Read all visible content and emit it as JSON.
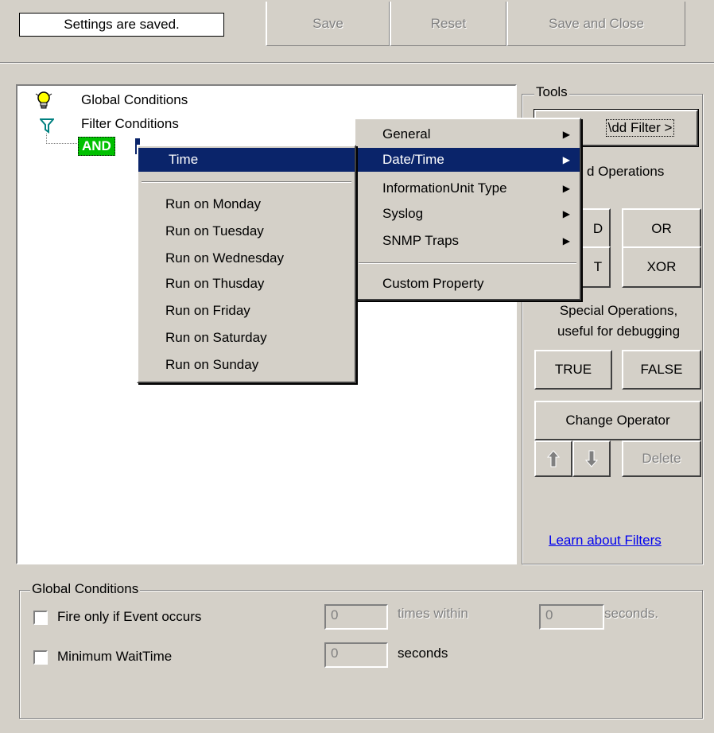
{
  "status_text": "Settings are saved.",
  "toolbar": {
    "save": "Save",
    "reset": "Reset",
    "save_close": "Save and Close"
  },
  "tree": {
    "global_conditions": "Global Conditions",
    "filter_conditions": "Filter Conditions",
    "and_node": "AND"
  },
  "tools": {
    "legend": "Tools",
    "add_filter": "Add Filter >",
    "add_filter_visible": "\\dd Filter >",
    "operations_label": "d Operations",
    "and_partial": "D",
    "or": "OR",
    "not_partial": "T",
    "xor": "XOR",
    "special_line1": "Special Operations,",
    "special_line2": "useful for debugging",
    "true": "TRUE",
    "false": "FALSE",
    "change_operator": "Change Operator",
    "delete": "Delete",
    "learn_link": "Learn about Filters"
  },
  "context_menu": {
    "items": [
      {
        "label": "General",
        "has_submenu": true
      },
      {
        "label": "Date/Time",
        "has_submenu": true,
        "selected": true
      },
      {
        "label": "InformationUnit Type",
        "has_submenu": true
      },
      {
        "label": "Syslog",
        "has_submenu": true
      },
      {
        "label": "SNMP Traps",
        "has_submenu": true
      },
      {
        "label": "Custom Property",
        "has_submenu": false
      }
    ]
  },
  "time_submenu": {
    "header": "Time",
    "items": [
      "Run on Monday",
      "Run on Tuesday",
      "Run on Wednesday",
      "Run on Thusday",
      "Run on Friday",
      "Run on Saturday",
      "Run on Sunday"
    ]
  },
  "global_conditions": {
    "legend": "Global Conditions",
    "fire_only_label": "Fire only if Event occurs",
    "fire_only_value": "0",
    "times_within": "times within",
    "seconds_value": "0",
    "seconds_dot": "seconds.",
    "min_wait_label": "Minimum WaitTime",
    "min_wait_value": "0",
    "seconds": "seconds"
  },
  "icons": {
    "bulb": "lightbulb-icon",
    "filter": "funnel-icon",
    "submenu": "triangle-right-icon",
    "up": "arrow-up-icon",
    "down": "arrow-down-icon"
  },
  "colors": {
    "menu_highlight": "#0a246a",
    "and_node_bg": "#00c000",
    "link": "#0000ee"
  }
}
